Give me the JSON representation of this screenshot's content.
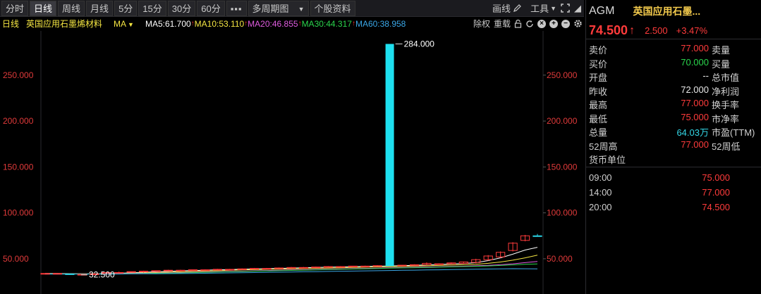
{
  "toolbar": {
    "buttons": [
      "分时",
      "日线",
      "周线",
      "月线",
      "5分",
      "15分",
      "30分",
      "60分",
      "▪▪▪"
    ],
    "active": "日线",
    "multi_period": "多周期图",
    "multi_arrow": "▼",
    "stock_info": "个股资料",
    "draw_line": "画线",
    "tools": "工具",
    "tools_arrow": "▼",
    "settings_arrow": "◢"
  },
  "ma_row": {
    "period": "日线",
    "name": "英国应用石墨烯材料",
    "ma_label": "MA",
    "ma_arrow": "▼",
    "ma5": "MA5:61.700",
    "ma10": "MA10:53.110",
    "ma20": "MA20:46.855",
    "ma30": "MA30:44.317",
    "ma60": "MA60:38.958",
    "up_mark": "↑",
    "fq": "除权",
    "overlay": "重载",
    "colors": {
      "ma5": "#ffffff",
      "ma10": "#f5e642",
      "ma20": "#e05ce0",
      "ma30": "#2ad44c",
      "ma60": "#3aa6e6"
    }
  },
  "chart_data": {
    "type": "candlestick",
    "y_ticks_left": [
      "250.000",
      "200.000",
      "150.000",
      "100.000",
      "50.000"
    ],
    "y_ticks_right": [
      "250.000",
      "200.000",
      "150.000",
      "100.000",
      "50.000"
    ],
    "y_tick_values": [
      250,
      200,
      150,
      100,
      50
    ],
    "ylim": [
      30,
      292
    ],
    "max_label": "284.000",
    "min_label": "32.500",
    "max_value": 284.0,
    "min_value": 32.5,
    "spike_color": "#1ee0f0",
    "candles": [
      [
        34,
        34,
        33,
        34
      ],
      [
        34,
        34,
        33,
        34
      ],
      [
        33.5,
        34,
        32.5,
        33
      ],
      [
        33,
        33.5,
        32.5,
        33
      ],
      [
        33,
        34,
        33,
        33.5
      ],
      [
        34,
        35,
        34,
        35
      ],
      [
        35,
        36,
        34,
        35
      ],
      [
        35.5,
        36,
        35,
        36
      ],
      [
        36,
        37,
        35,
        36.5
      ],
      [
        36.5,
        37,
        36,
        37
      ],
      [
        37,
        38,
        36.5,
        37.5
      ],
      [
        37,
        38,
        37,
        37.5
      ],
      [
        37.5,
        38,
        37,
        38
      ],
      [
        38,
        38.5,
        37.5,
        38
      ],
      [
        38,
        39,
        37.5,
        38.5
      ],
      [
        38.5,
        39,
        38,
        38.5
      ],
      [
        38.5,
        39.5,
        38,
        39
      ],
      [
        39,
        40,
        38.5,
        39.5
      ],
      [
        39.5,
        40,
        39,
        39.5
      ],
      [
        39.5,
        40.5,
        39,
        40
      ],
      [
        40,
        41,
        39.5,
        40.5
      ],
      [
        40.5,
        41,
        40,
        40.5
      ],
      [
        40.5,
        41.5,
        40,
        41
      ],
      [
        41,
        42,
        40.5,
        41.5
      ],
      [
        41.5,
        42,
        41,
        41.5
      ],
      [
        41.5,
        42,
        41,
        42
      ],
      [
        42,
        42.5,
        41.5,
        42
      ],
      [
        42,
        43,
        41.5,
        42.5
      ],
      [
        42,
        284,
        42,
        284
      ],
      [
        42.5,
        43,
        42,
        43
      ],
      [
        43,
        44,
        42.5,
        43.5
      ],
      [
        43.5,
        46,
        43,
        45
      ],
      [
        44,
        45,
        43.5,
        44.5
      ],
      [
        44.5,
        46,
        44,
        45.5
      ],
      [
        45,
        47,
        44.5,
        46.5
      ],
      [
        46,
        50,
        45,
        49
      ],
      [
        49,
        54,
        48,
        53
      ],
      [
        52,
        58,
        51,
        57
      ],
      [
        59,
        68,
        58,
        67
      ],
      [
        70,
        76,
        69,
        75
      ],
      [
        75,
        77,
        74.5,
        74.5
      ]
    ],
    "ma_lines": [
      {
        "name": "MA5",
        "color": "#ffffff",
        "values": [
          34,
          34,
          33.8,
          33.6,
          33.5,
          33.8,
          34.2,
          34.8,
          35.3,
          35.8,
          36.3,
          36.8,
          37.2,
          37.6,
          38,
          38.3,
          38.6,
          38.9,
          39.2,
          39.5,
          39.9,
          40.2,
          40.5,
          40.8,
          41.1,
          41.4,
          41.6,
          41.9,
          42.2,
          42.5,
          42.8,
          43.3,
          43.8,
          44.3,
          44.9,
          45.8,
          48,
          51,
          55,
          59.5,
          62.5
        ]
      },
      {
        "name": "MA10",
        "color": "#f5e642",
        "values": [
          33.8,
          33.8,
          33.7,
          33.6,
          33.6,
          33.7,
          33.9,
          34.2,
          34.6,
          35,
          35.4,
          35.8,
          36.2,
          36.6,
          37,
          37.4,
          37.8,
          38.1,
          38.4,
          38.7,
          39,
          39.3,
          39.6,
          39.9,
          40.2,
          40.5,
          40.8,
          41.1,
          41.4,
          41.7,
          42,
          42.3,
          42.7,
          43.1,
          43.5,
          44,
          45,
          46.5,
          48.5,
          51,
          54
        ]
      },
      {
        "name": "MA20",
        "color": "#e05ce0",
        "values": [
          33.6,
          33.6,
          33.6,
          33.6,
          33.6,
          33.7,
          33.8,
          34,
          34.2,
          34.4,
          34.7,
          35,
          35.3,
          35.6,
          35.9,
          36.2,
          36.5,
          36.8,
          37.1,
          37.4,
          37.7,
          38,
          38.3,
          38.6,
          38.9,
          39.2,
          39.5,
          39.8,
          40.1,
          40.4,
          40.7,
          41,
          41.3,
          41.6,
          41.9,
          42.3,
          42.8,
          43.5,
          44.5,
          45.8,
          47
        ]
      },
      {
        "name": "MA30",
        "color": "#2ad44c",
        "values": [
          33.5,
          33.5,
          33.5,
          33.5,
          33.5,
          33.6,
          33.7,
          33.8,
          34,
          34.2,
          34.4,
          34.6,
          34.9,
          35.2,
          35.5,
          35.8,
          36.1,
          36.4,
          36.7,
          37,
          37.3,
          37.6,
          37.9,
          38.2,
          38.5,
          38.8,
          39.1,
          39.4,
          39.7,
          40,
          40.3,
          40.6,
          40.9,
          41.2,
          41.5,
          41.8,
          42.2,
          42.7,
          43.3,
          44,
          44.3
        ]
      },
      {
        "name": "MA60",
        "color": "#3aa6e6",
        "values": [
          33.2,
          33.2,
          33.2,
          33.2,
          33.2,
          33.3,
          33.4,
          33.5,
          33.6,
          33.7,
          33.8,
          33.9,
          34,
          34.2,
          34.4,
          34.6,
          34.8,
          35,
          35.2,
          35.4,
          35.6,
          35.8,
          36,
          36.2,
          36.4,
          36.6,
          36.8,
          37,
          37.2,
          37.4,
          37.6,
          37.8,
          38,
          38.2,
          38.4,
          38.6,
          38.8,
          39,
          39.2,
          39.1,
          38.96
        ]
      }
    ]
  },
  "panel": {
    "code": "AGM",
    "name": "英国应用石墨...",
    "price": "74.500",
    "price_arrow": "↑",
    "change": "2.500",
    "change_pct": "+3.47%",
    "quote": [
      {
        "l": "卖价",
        "v": "77.000",
        "c": "red",
        "r": "卖量"
      },
      {
        "l": "买价",
        "v": "70.000",
        "c": "green",
        "r": "买量"
      },
      {
        "l": "开盘",
        "v": "--",
        "c": "white",
        "r": "总市值"
      },
      {
        "l": "昨收",
        "v": "72.000",
        "c": "white",
        "r": "净利润"
      },
      {
        "l": "最高",
        "v": "77.000",
        "c": "red",
        "r": "换手率"
      },
      {
        "l": "最低",
        "v": "75.000",
        "c": "red",
        "r": "市净率"
      },
      {
        "l": "总量",
        "v": "64.03万",
        "c": "cyan",
        "r": "市盈(TTM)"
      },
      {
        "l": "52周高",
        "v": "77.000",
        "c": "red",
        "r": "52周低"
      },
      {
        "l": "货币单位",
        "v": "",
        "c": "white",
        "r": ""
      }
    ],
    "ticks": [
      {
        "t": "09:00",
        "p": "75.000"
      },
      {
        "t": "14:00",
        "p": "77.000"
      },
      {
        "t": "20:00",
        "p": "74.500"
      }
    ]
  }
}
